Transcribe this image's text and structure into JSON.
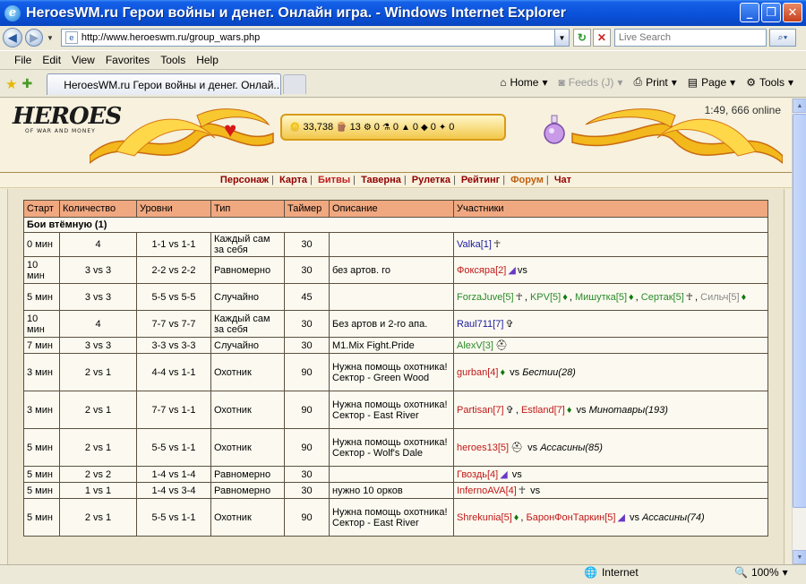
{
  "window": {
    "title": "HeroesWM.ru Герои войны и денег. Онлайн игра. - Windows Internet Explorer",
    "minimize": "_",
    "maximize": "❐",
    "close": "✕"
  },
  "address": {
    "url": "http://www.heroeswm.ru/group_wars.php",
    "search_placeholder": "Live Search"
  },
  "menu": [
    "File",
    "Edit",
    "View",
    "Favorites",
    "Tools",
    "Help"
  ],
  "tab": {
    "label": "HeroesWM.ru Герои войны и денег. Онлай..."
  },
  "commands": {
    "home": "Home",
    "feeds": "Feeds (J)",
    "print": "Print",
    "page": "Page",
    "tools": "Tools"
  },
  "game": {
    "logo": "HEROES",
    "logo_sub": "OF WAR AND MONEY",
    "online": "1:49, 666 online",
    "resources": [
      "33,738",
      "13",
      "0",
      "0",
      "0",
      "0",
      "0"
    ],
    "nav": [
      {
        "label": "Персонаж",
        "style": "normal"
      },
      {
        "label": "Карта",
        "style": "normal"
      },
      {
        "label": "Битвы",
        "style": "active"
      },
      {
        "label": "Таверна",
        "style": "normal"
      },
      {
        "label": "Рулетка",
        "style": "normal"
      },
      {
        "label": "Рейтинг",
        "style": "normal"
      },
      {
        "label": "Форум",
        "style": "forum"
      },
      {
        "label": "Чат",
        "style": "normal"
      }
    ]
  },
  "table": {
    "headers": [
      "Старт",
      "Количество",
      "Уровни",
      "Тип",
      "Таймер",
      "Описание",
      "Участники"
    ],
    "section": "Бои втёмную (1)",
    "rows": [
      {
        "start": "0 мин",
        "count": "4",
        "levels": "1-1 vs 1-1",
        "type": "Каждый сам за себя",
        "timer": "30",
        "desc": "",
        "players": [
          {
            "t": "Valka[1]",
            "c": "blue"
          },
          {
            "i": "ankh",
            "c": "black"
          }
        ]
      },
      {
        "start": "10 мин",
        "count": "3 vs 3",
        "levels": "2-2 vs 2-2",
        "type": "Равномерно",
        "timer": "30",
        "desc": "без артов. го",
        "players": [
          {
            "t": "Фоксяра[2]",
            "c": "red"
          },
          {
            "i": "hat",
            "c": "purple"
          },
          {
            "t": "vs",
            "c": "plain"
          }
        ]
      },
      {
        "start": "5 мин",
        "count": "3 vs 3",
        "levels": "5-5 vs 5-5",
        "type": "Случайно",
        "timer": "45",
        "desc": "",
        "players": [
          {
            "t": "ForzaJuve[5]",
            "c": "green"
          },
          {
            "i": "ankh",
            "c": "black"
          },
          {
            "t": ", ",
            "c": "plain"
          },
          {
            "t": "KPV[5]",
            "c": "green"
          },
          {
            "i": "leaf",
            "c": "green"
          },
          {
            "t": ", ",
            "c": "plain"
          },
          {
            "t": "Мишутка[5]",
            "c": "green"
          },
          {
            "i": "leaf",
            "c": "green"
          },
          {
            "t": ", ",
            "c": "plain"
          },
          {
            "t": "Сертак[5]",
            "c": "green"
          },
          {
            "i": "ankh",
            "c": "black"
          },
          {
            "t": ", ",
            "c": "plain"
          },
          {
            "t": "Сильч[5]",
            "c": "gray"
          },
          {
            "i": "leaf",
            "c": "green"
          }
        ]
      },
      {
        "start": "10 мин",
        "count": "4",
        "levels": "7-7 vs 7-7",
        "type": "Каждый сам за себя",
        "timer": "30",
        "desc": "Без артов и 2-го апа.",
        "players": [
          {
            "t": "Raul711[7]",
            "c": "blue"
          },
          {
            "i": "cross",
            "c": "black"
          }
        ]
      },
      {
        "start": "7 мин",
        "count": "3 vs 3",
        "levels": "3-3 vs 3-3",
        "type": "Случайно",
        "timer": "30",
        "desc": "M1.Mix Fight.Pride",
        "players": [
          {
            "t": "AlexV[3]",
            "c": "green"
          },
          {
            "i": "helm",
            "c": "black"
          }
        ]
      },
      {
        "start": "3 мин",
        "count": "2 vs 1",
        "levels": "4-4 vs 1-1",
        "type": "Охотник",
        "timer": "90",
        "desc": "Нужна помощь охотника!\nСектор - Green Wood",
        "players": [
          {
            "t": "gurban[4]",
            "c": "red"
          },
          {
            "i": "leaf",
            "c": "green"
          },
          {
            "t": " vs ",
            "c": "plain"
          },
          {
            "t": "Бестии(28)",
            "c": "enemy"
          }
        ]
      },
      {
        "start": "3 мин",
        "count": "2 vs 1",
        "levels": "7-7 vs 1-1",
        "type": "Охотник",
        "timer": "90",
        "desc": "Нужна помощь охотника!\nСектор - East River",
        "players": [
          {
            "t": "Partisan[7]",
            "c": "red"
          },
          {
            "i": "cross",
            "c": "black"
          },
          {
            "t": ", ",
            "c": "plain"
          },
          {
            "t": "Estland[7]",
            "c": "red"
          },
          {
            "i": "leaf",
            "c": "green"
          },
          {
            "t": " vs ",
            "c": "plain"
          },
          {
            "t": "Минотавры(193)",
            "c": "enemy"
          }
        ]
      },
      {
        "start": "5 мин",
        "count": "2 vs 1",
        "levels": "5-5 vs 1-1",
        "type": "Охотник",
        "timer": "90",
        "desc": "Нужна помощь охотника!\nСектор - Wolf's Dale",
        "players": [
          {
            "t": "heroes13[5]",
            "c": "red"
          },
          {
            "i": "helm",
            "c": "black"
          },
          {
            "t": " vs ",
            "c": "plain"
          },
          {
            "t": "Ассасины(85)",
            "c": "enemy"
          }
        ]
      },
      {
        "start": "5 мин",
        "count": "2 vs 2",
        "levels": "1-4 vs 1-4",
        "type": "Равномерно",
        "timer": "30",
        "desc": "",
        "players": [
          {
            "t": "Гвоздь[4]",
            "c": "red"
          },
          {
            "i": "hat",
            "c": "purple"
          },
          {
            "t": " vs",
            "c": "plain"
          }
        ]
      },
      {
        "start": "5 мин",
        "count": "1 vs 1",
        "levels": "1-4 vs 3-4",
        "type": "Равномерно",
        "timer": "30",
        "desc": "нужно 10 орков",
        "players": [
          {
            "t": "InfernoAVA[4]",
            "c": "red"
          },
          {
            "i": "ankh",
            "c": "black"
          },
          {
            "t": " vs",
            "c": "plain"
          }
        ]
      },
      {
        "start": "5 мин",
        "count": "2 vs 1",
        "levels": "5-5 vs 1-1",
        "type": "Охотник",
        "timer": "90",
        "desc": "Нужна помощь охотника!\nСектор - East River",
        "players": [
          {
            "t": "Shrekunia[5]",
            "c": "red"
          },
          {
            "i": "leaf",
            "c": "green"
          },
          {
            "t": ", ",
            "c": "plain"
          },
          {
            "t": "БаронФонТаркин[5]",
            "c": "red"
          },
          {
            "i": "hat",
            "c": "purple"
          },
          {
            "t": " vs ",
            "c": "plain"
          },
          {
            "t": "Ассасины(74)",
            "c": "enemy"
          }
        ]
      }
    ]
  },
  "status": {
    "zone": "Internet",
    "zoom": "100%"
  },
  "icons": {
    "ankh": "☥",
    "cross": "✞",
    "leaf": "♦",
    "hat": "◢",
    "helm": "⛑"
  }
}
